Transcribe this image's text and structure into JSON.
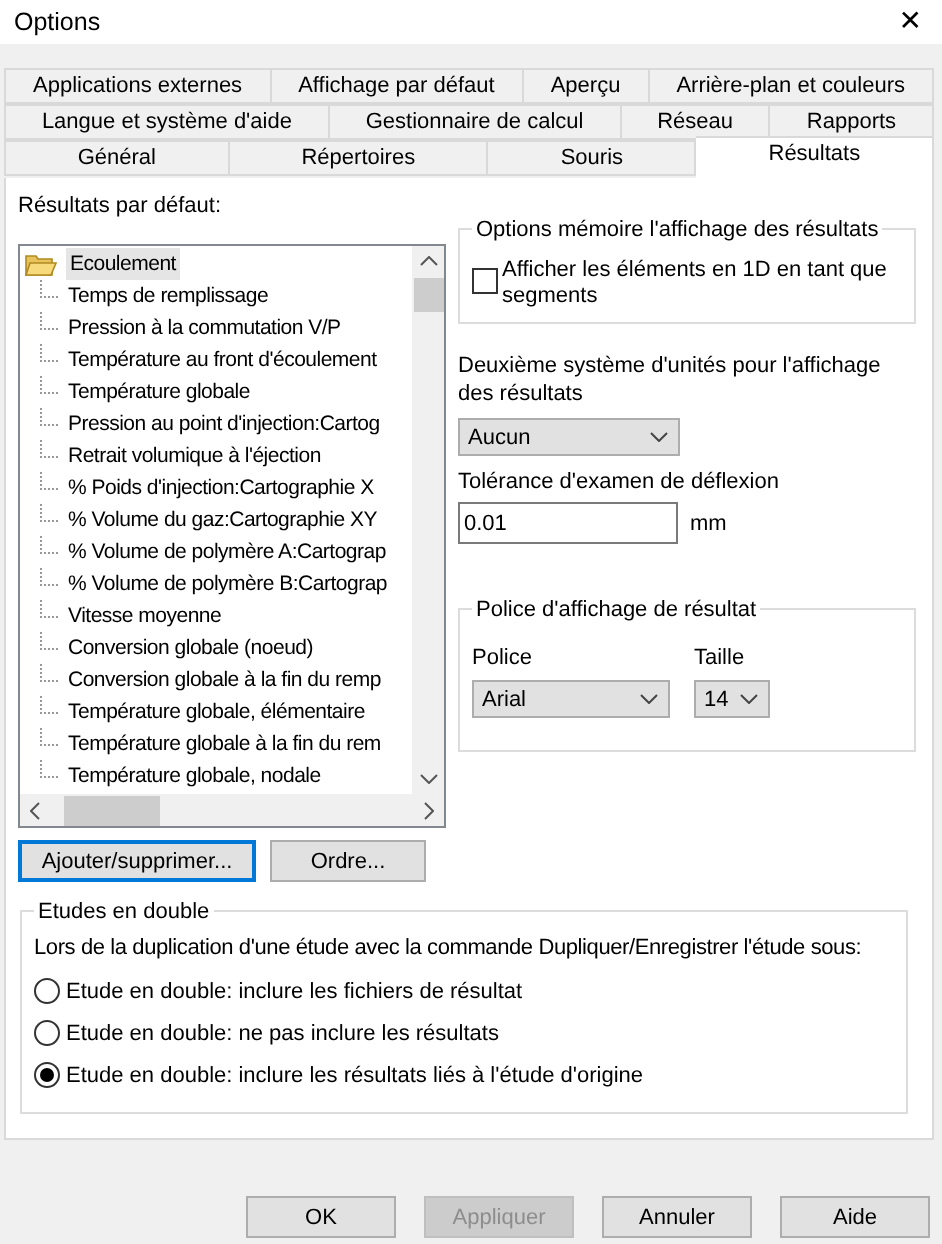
{
  "window": {
    "title": "Options",
    "close": "✕"
  },
  "tab_rows": [
    [
      {
        "label": "Applications externes",
        "selected": false
      },
      {
        "label": "Affichage par défaut",
        "selected": false
      },
      {
        "label": "Aperçu",
        "selected": false
      },
      {
        "label": "Arrière-plan et couleurs",
        "selected": false
      }
    ],
    [
      {
        "label": "Langue et système d'aide",
        "selected": false
      },
      {
        "label": "Gestionnaire de calcul",
        "selected": false
      },
      {
        "label": "Réseau",
        "selected": false
      },
      {
        "label": "Rapports",
        "selected": false
      }
    ],
    [
      {
        "label": "Général",
        "selected": false
      },
      {
        "label": "Répertoires",
        "selected": false
      },
      {
        "label": "Souris",
        "selected": false
      },
      {
        "label": "Résultats",
        "selected": true
      }
    ]
  ],
  "default_results": {
    "label": "Résultats par défaut:",
    "tree": [
      {
        "label": "Ecoulement",
        "selected": true,
        "children": [
          {
            "label": "Temps de remplissage",
            "selected": false
          },
          {
            "label": "Pression à la commutation V/P",
            "selected": false
          },
          {
            "label": "Température au front d'écoulement",
            "selected": false
          },
          {
            "label": "Température globale",
            "selected": false
          },
          {
            "label": "Pression au point d'injection:Cartog",
            "selected": false
          },
          {
            "label": "Retrait volumique à l'éjection",
            "selected": false
          },
          {
            "label": "% Poids d'injection:Cartographie X",
            "selected": false
          },
          {
            "label": "% Volume du gaz:Cartographie XY",
            "selected": false
          },
          {
            "label": "% Volume de polymère A:Cartograp",
            "selected": false
          },
          {
            "label": "% Volume de polymère B:Cartograp",
            "selected": false
          },
          {
            "label": "Vitesse moyenne",
            "selected": false
          },
          {
            "label": "Conversion globale (noeud)",
            "selected": false
          },
          {
            "label": "Conversion globale à la fin du remp",
            "selected": false
          },
          {
            "label": "Température globale, élémentaire",
            "selected": false
          },
          {
            "label": "Température globale à la fin du rem",
            "selected": false
          },
          {
            "label": "Température globale, nodale",
            "selected": false
          }
        ]
      }
    ],
    "buttons": [
      {
        "label": "Ajouter/supprimer...",
        "focused": true
      },
      {
        "label": "Ordre...",
        "focused": false
      }
    ]
  },
  "memory_options": {
    "title": "Options mémoire l'affichage des résultats",
    "checkbox": {
      "label": "Afficher les éléments en 1D en tant que segments",
      "checked": false
    }
  },
  "second_units": {
    "label": "Deuxième système d'unités pour l'affichage des résultats",
    "value": "Aucun"
  },
  "deflection": {
    "label": "Tolérance d'examen de déflexion",
    "value": "0.01",
    "unit": "mm"
  },
  "result_font": {
    "title": "Police d'affichage de résultat",
    "font_label": "Police",
    "font_value": "Arial",
    "size_label": "Taille",
    "size_value": "14"
  },
  "duplicate": {
    "title": "Etudes en double",
    "description": "Lors de la duplication d'une étude avec la commande Dupliquer/Enregistrer l'étude sous:",
    "options": [
      {
        "label": "Etude en double: inclure les fichiers de résultat",
        "selected": false
      },
      {
        "label": "Etude en double: ne pas inclure les résultats",
        "selected": false
      },
      {
        "label": "Etude en double: inclure les résultats liés à l'étude d'origine",
        "selected": true
      }
    ]
  },
  "footer_buttons": [
    {
      "label": "OK",
      "disabled": false
    },
    {
      "label": "Appliquer",
      "disabled": true
    },
    {
      "label": "Annuler",
      "disabled": false
    },
    {
      "label": "Aide",
      "disabled": false
    }
  ]
}
